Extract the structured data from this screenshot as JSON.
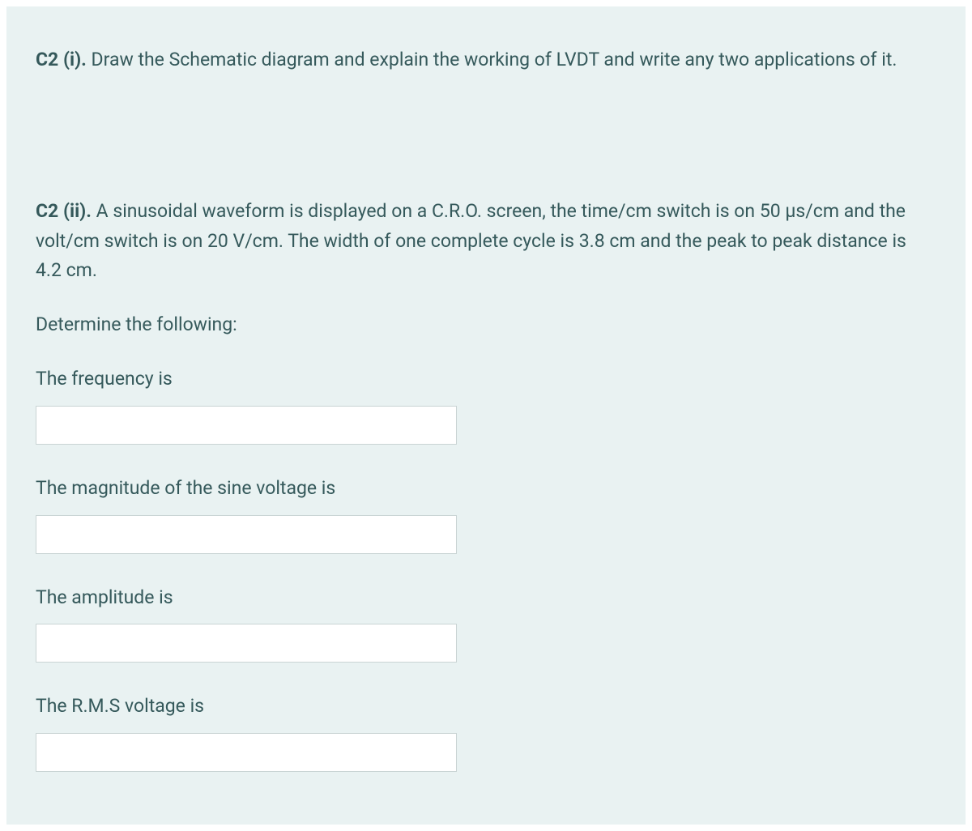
{
  "q1": {
    "label": "C2 (i).",
    "text": " Draw the Schematic diagram and explain the working of LVDT and write any two applications of it."
  },
  "q2": {
    "label": "C2 (ii).",
    "text": " A sinusoidal waveform is displayed on a C.R.O. screen, the time/cm switch is on 50 µs/cm and the volt/cm switch is on 20 V/cm. The width of one complete cycle is 3.8 cm and the peak to peak distance is 4.2 cm.",
    "prompt": "Determine the following:",
    "fields": [
      {
        "label": "The frequency is",
        "value": ""
      },
      {
        "label": "The magnitude of the sine voltage is",
        "value": ""
      },
      {
        "label": "The amplitude is",
        "value": ""
      },
      {
        "label": "The R.M.S voltage is",
        "value": ""
      }
    ]
  }
}
